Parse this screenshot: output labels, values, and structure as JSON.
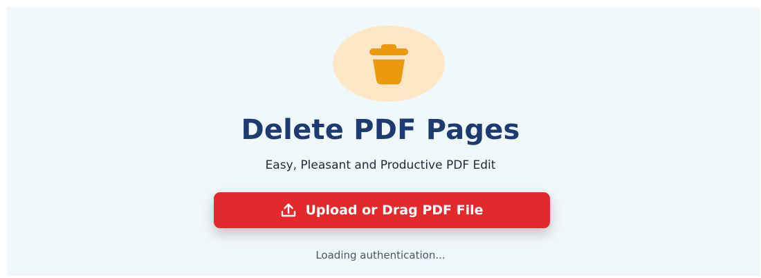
{
  "hero": {
    "icon": "trash-icon",
    "title": "Delete PDF Pages",
    "subtitle": "Easy, Pleasant and Productive PDF Edit"
  },
  "upload": {
    "icon": "upload-icon",
    "label": "Upload or Drag PDF File"
  },
  "status": {
    "text": "Loading authentication..."
  },
  "colors": {
    "panel_background": "#f1f8fc",
    "icon_circle": "#fde7c7",
    "icon": "#ea9a0c",
    "title": "#1e3a70",
    "button": "#e4292c",
    "button_text": "#ffffff"
  }
}
